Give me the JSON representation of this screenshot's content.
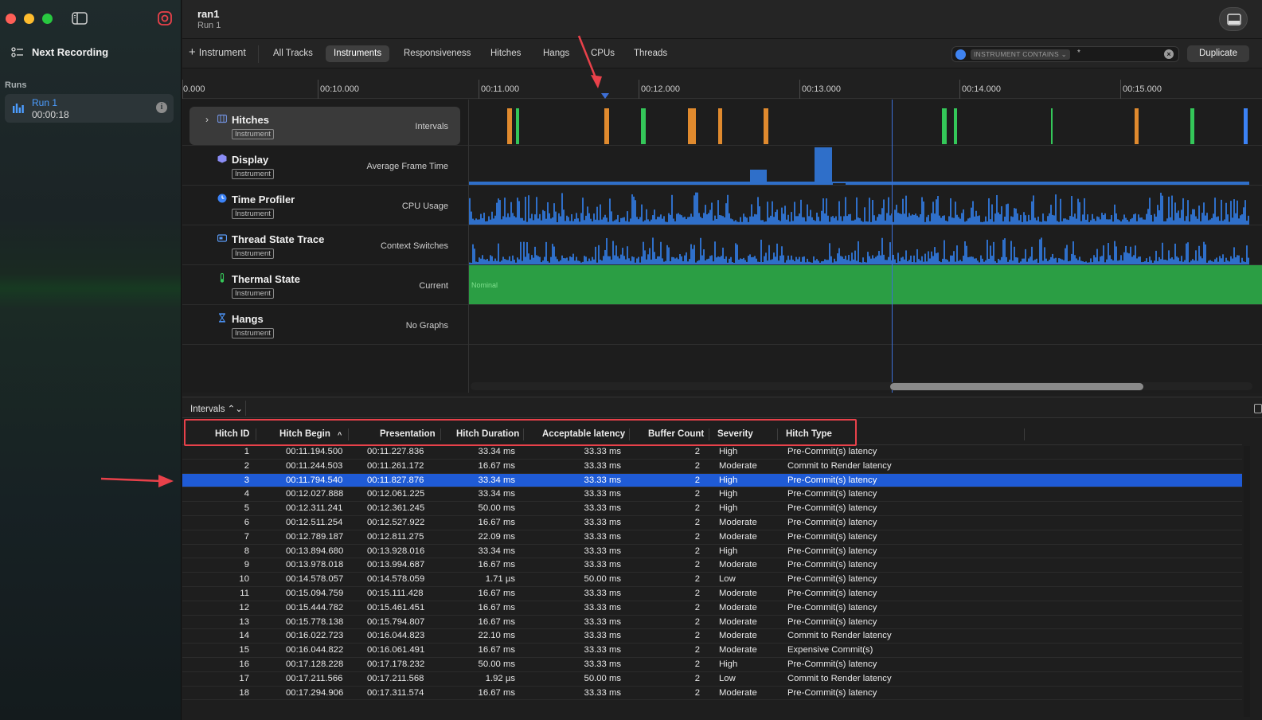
{
  "window": {
    "doc_title": "ran1",
    "doc_subtitle": "Run 1"
  },
  "sidebar": {
    "next_recording": "Next Recording",
    "runs_label": "Runs",
    "run": {
      "name": "Run 1",
      "time": "00:00:18"
    }
  },
  "toolbar": {
    "add_instrument": "Instrument",
    "tabs": [
      {
        "label": "All Tracks"
      },
      {
        "label": "Instruments"
      },
      {
        "label": "Responsiveness"
      },
      {
        "label": "Hitches"
      },
      {
        "label": "Hangs"
      },
      {
        "label": "CPUs"
      },
      {
        "label": "Threads"
      }
    ],
    "active_tab": "Instruments",
    "filter_token": "INSTRUMENT CONTAINS ⌄",
    "filter_value": "*",
    "duplicate": "Duplicate"
  },
  "ruler": {
    "labels": [
      "0.000",
      "00:10.000",
      "00:11.000",
      "00:12.000",
      "00:13.000",
      "00:14.000",
      "00:15.000"
    ]
  },
  "tracks": [
    {
      "name": "Hitches",
      "tag": "Instrument",
      "detail": "Intervals",
      "icon": "hitches-icon",
      "color": "#6f8ed8"
    },
    {
      "name": "Display",
      "tag": "Instrument",
      "detail": "Average Frame Time",
      "icon": "display-icon",
      "color": "#8a8cf5"
    },
    {
      "name": "Time Profiler",
      "tag": "Instrument",
      "detail": "CPU Usage",
      "icon": "time-profiler-icon",
      "color": "#3b82f6"
    },
    {
      "name": "Thread State Trace",
      "tag": "Instrument",
      "detail": "Context Switches",
      "icon": "thread-state-icon",
      "color": "#5a9af5"
    },
    {
      "name": "Thermal State",
      "tag": "Instrument",
      "detail": "Current",
      "icon": "thermometer-icon",
      "color": "#35c759"
    },
    {
      "name": "Hangs",
      "tag": "Instrument",
      "detail": "No Graphs",
      "icon": "hourglass-icon",
      "color": "#4a90f0"
    }
  ],
  "thermal_value": "Nominal",
  "detail": {
    "selector": "Intervals ⌃⌄"
  },
  "table": {
    "columns": [
      "Hitch ID",
      "Hitch Begin",
      "Presentation",
      "Hitch Duration",
      "Acceptable latency",
      "Buffer Count",
      "Severity",
      "Hitch Type"
    ],
    "sort_indicator": "^",
    "selected_row": 3,
    "rows": [
      [
        "1",
        "00:11.194.500",
        "00:11.227.836",
        "33.34 ms",
        "33.33 ms",
        "2",
        "High",
        "Pre-Commit(s) latency"
      ],
      [
        "2",
        "00:11.244.503",
        "00:11.261.172",
        "16.67 ms",
        "33.33 ms",
        "2",
        "Moderate",
        "Commit to Render latency"
      ],
      [
        "3",
        "00:11.794.540",
        "00:11.827.876",
        "33.34 ms",
        "33.33 ms",
        "2",
        "High",
        "Pre-Commit(s) latency"
      ],
      [
        "4",
        "00:12.027.888",
        "00:12.061.225",
        "33.34 ms",
        "33.33 ms",
        "2",
        "High",
        "Pre-Commit(s) latency"
      ],
      [
        "5",
        "00:12.311.241",
        "00:12.361.245",
        "50.00 ms",
        "33.33 ms",
        "2",
        "High",
        "Pre-Commit(s) latency"
      ],
      [
        "6",
        "00:12.511.254",
        "00:12.527.922",
        "16.67 ms",
        "33.33 ms",
        "2",
        "Moderate",
        "Pre-Commit(s) latency"
      ],
      [
        "7",
        "00:12.789.187",
        "00:12.811.275",
        "22.09 ms",
        "33.33 ms",
        "2",
        "Moderate",
        "Pre-Commit(s) latency"
      ],
      [
        "8",
        "00:13.894.680",
        "00:13.928.016",
        "33.34 ms",
        "33.33 ms",
        "2",
        "High",
        "Pre-Commit(s) latency"
      ],
      [
        "9",
        "00:13.978.018",
        "00:13.994.687",
        "16.67 ms",
        "33.33 ms",
        "2",
        "Moderate",
        "Pre-Commit(s) latency"
      ],
      [
        "10",
        "00:14.578.057",
        "00:14.578.059",
        "1.71 µs",
        "50.00 ms",
        "2",
        "Low",
        "Pre-Commit(s) latency"
      ],
      [
        "11",
        "00:15.094.759",
        "00:15.111.428",
        "16.67 ms",
        "33.33 ms",
        "2",
        "Moderate",
        "Pre-Commit(s) latency"
      ],
      [
        "12",
        "00:15.444.782",
        "00:15.461.451",
        "16.67 ms",
        "33.33 ms",
        "2",
        "Moderate",
        "Pre-Commit(s) latency"
      ],
      [
        "13",
        "00:15.778.138",
        "00:15.794.807",
        "16.67 ms",
        "33.33 ms",
        "2",
        "Moderate",
        "Pre-Commit(s) latency"
      ],
      [
        "14",
        "00:16.022.723",
        "00:16.044.823",
        "22.10 ms",
        "33.33 ms",
        "2",
        "Moderate",
        "Commit to Render latency"
      ],
      [
        "15",
        "00:16.044.822",
        "00:16.061.491",
        "16.67 ms",
        "33.33 ms",
        "2",
        "Moderate",
        "Expensive Commit(s)"
      ],
      [
        "16",
        "00:17.128.228",
        "00:17.178.232",
        "50.00 ms",
        "33.33 ms",
        "2",
        "High",
        "Pre-Commit(s) latency"
      ],
      [
        "17",
        "00:17.211.566",
        "00:17.211.568",
        "1.92 µs",
        "50.00 ms",
        "2",
        "Low",
        "Commit to Render latency"
      ],
      [
        "18",
        "00:17.294.906",
        "00:17.311.574",
        "16.67 ms",
        "33.33 ms",
        "2",
        "Moderate",
        "Pre-Commit(s) latency"
      ]
    ]
  },
  "colors": {
    "accent": "#1f5bd6",
    "hitch_orange": "#e08a2e",
    "hitch_green": "#34c759",
    "bar_blue": "#2f6fc9",
    "annotation_red": "#e8414a"
  }
}
